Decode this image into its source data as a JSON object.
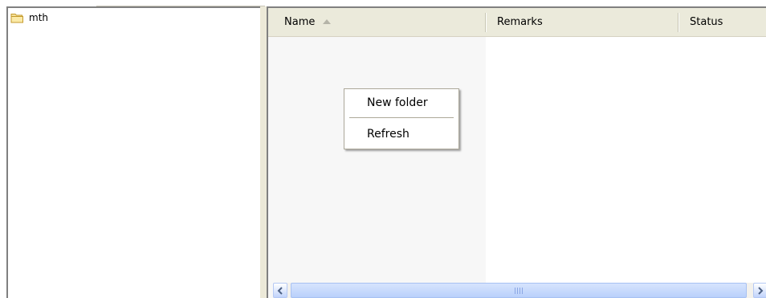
{
  "tree": {
    "root_label": "mth",
    "root_icon": "folder-open-icon"
  },
  "list": {
    "columns": [
      {
        "label": "Name",
        "sorted": "ascending"
      },
      {
        "label": "Remarks"
      },
      {
        "label": "Status"
      }
    ],
    "rows": []
  },
  "context_menu": {
    "items": [
      {
        "label": "New folder"
      },
      {
        "label": "Refresh"
      }
    ]
  },
  "scrollbar": {
    "left_icon": "chevron-left-icon",
    "right_icon": "chevron-right-icon",
    "thumb_icon": "grip-icon"
  },
  "colors": {
    "header_bg": "#ebeadb",
    "folder_yellow": "#f4d77a",
    "scroll_blue": "#b9d0fb"
  }
}
